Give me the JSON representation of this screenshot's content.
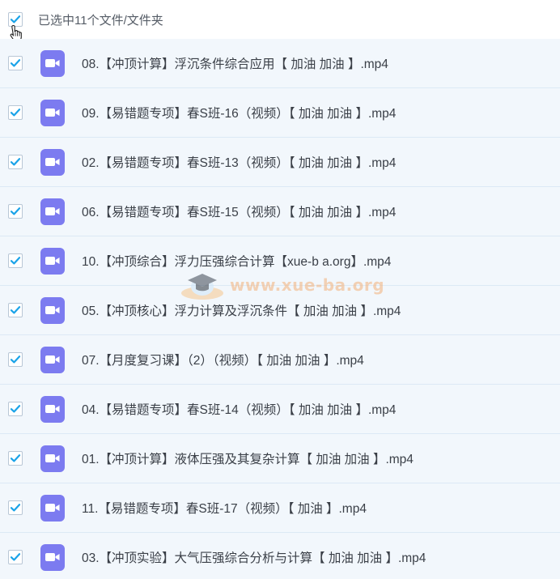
{
  "header": {
    "selection_label": "已选中11个文件/文件夹"
  },
  "colors": {
    "row_background": "#f2f7fc",
    "checkbox_tick": "#1aa3e8",
    "video_icon": "#7c7bf0",
    "watermark": "#f2b27a"
  },
  "icons": {
    "checkbox": "checkmark-icon",
    "file": "video-file-icon",
    "cursor": "hand-pointer-icon"
  },
  "files": [
    {
      "name": "08.【冲顶计算】浮沉条件综合应用【 加油 加油 】.mp4",
      "checked": true
    },
    {
      "name": "09.【易错题专项】春S班-16（视频）【 加油 加油 】.mp4",
      "checked": true
    },
    {
      "name": "02.【易错题专项】春S班-13（视频）【 加油 加油 】.mp4",
      "checked": true
    },
    {
      "name": "06.【易错题专项】春S班-15（视频）【 加油 加油 】.mp4",
      "checked": true
    },
    {
      "name": "10.【冲顶综合】浮力压强综合计算【xue-b a.org】.mp4",
      "checked": true
    },
    {
      "name": "05.【冲顶核心】浮力计算及浮沉条件【 加油 加油 】.mp4",
      "checked": true
    },
    {
      "name": "07.【月度复习课】（2）（视频）【 加油 加油 】.mp4",
      "checked": true
    },
    {
      "name": "04.【易错题专项】春S班-14（视频）【 加油 加油 】.mp4",
      "checked": true
    },
    {
      "name": "01.【冲顶计算】液体压强及其复杂计算【 加油 加油 】.mp4",
      "checked": true
    },
    {
      "name": "11.【易错题专项】春S班-17（视频）【 加油 】.mp4",
      "checked": true
    },
    {
      "name": "03.【冲顶实验】大气压强综合分析与计算【 加油 加油 】.mp4",
      "checked": true
    }
  ],
  "watermark": {
    "text": "www.xue-ba.org"
  }
}
